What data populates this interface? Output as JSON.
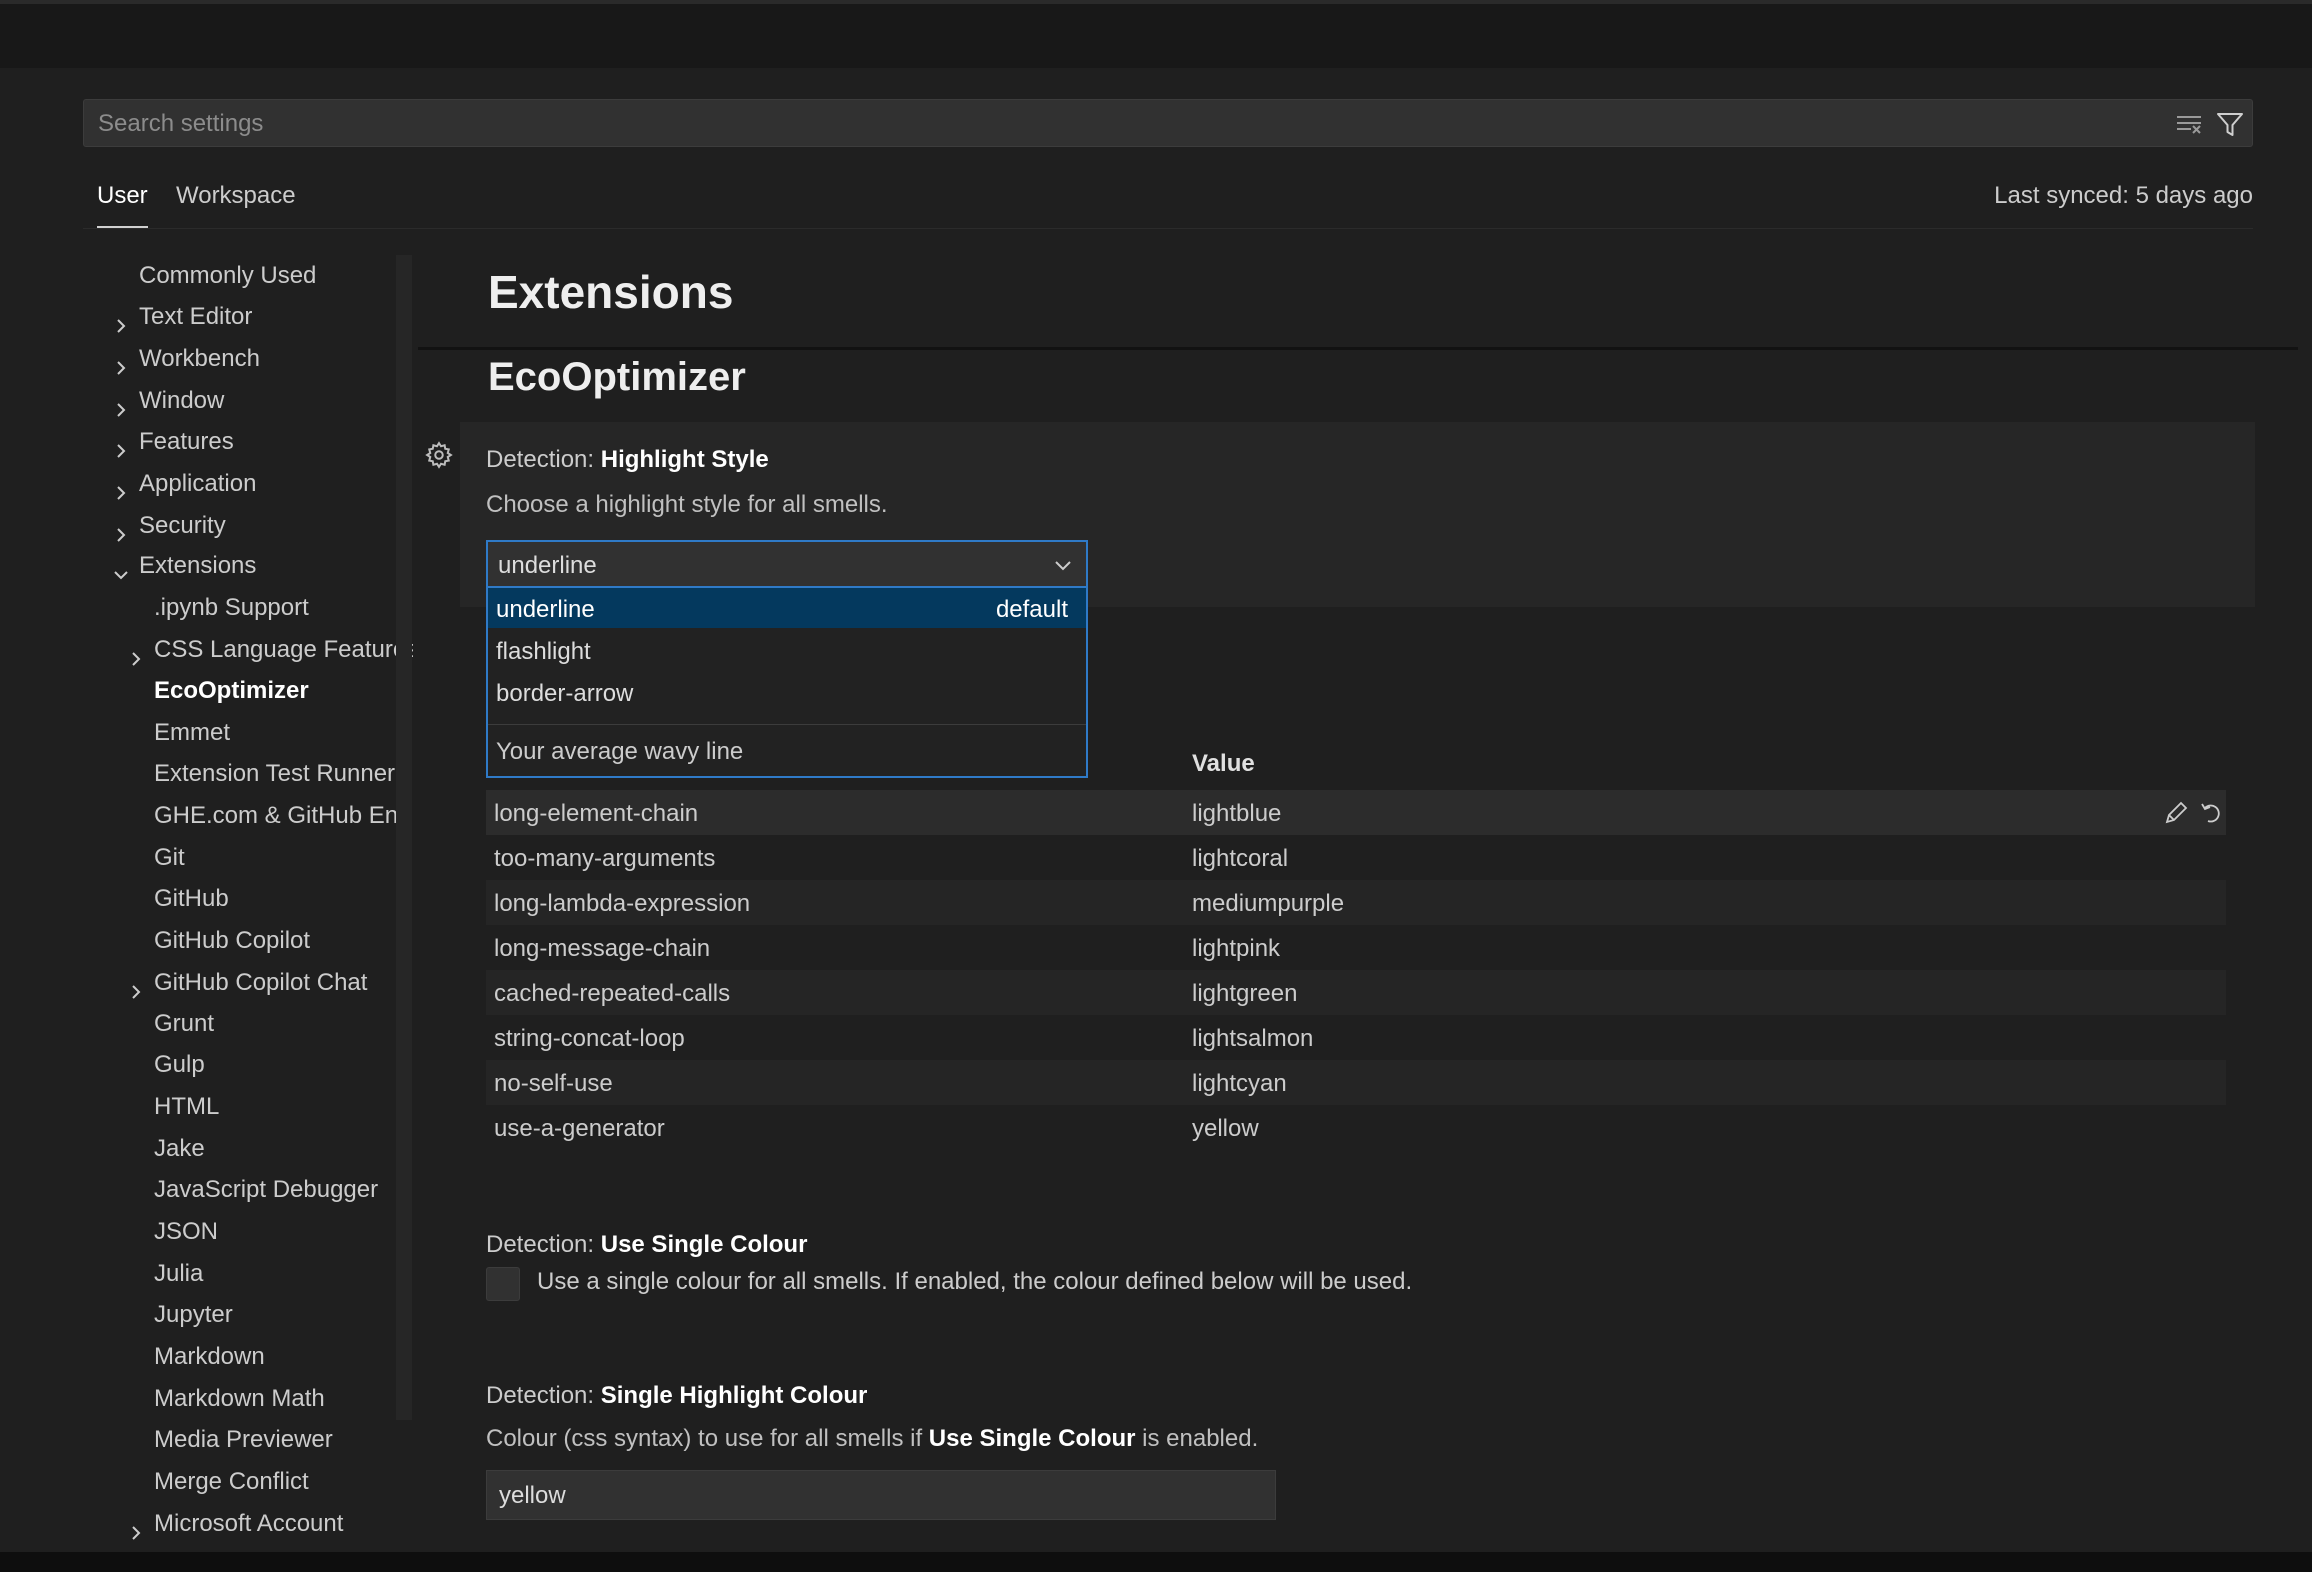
{
  "search": {
    "placeholder": "Search settings"
  },
  "tabs": [
    {
      "label": "User"
    },
    {
      "label": "Workspace"
    }
  ],
  "sync_status": "Last synced: 5 days ago",
  "toc": [
    {
      "label": "Commonly Used",
      "chevron": "none"
    },
    {
      "label": "Text Editor",
      "chevron": "right"
    },
    {
      "label": "Workbench",
      "chevron": "right"
    },
    {
      "label": "Window",
      "chevron": "right"
    },
    {
      "label": "Features",
      "chevron": "right"
    },
    {
      "label": "Application",
      "chevron": "right"
    },
    {
      "label": "Security",
      "chevron": "right"
    },
    {
      "label": "Extensions",
      "chevron": "down"
    },
    {
      "label": ".ipynb Support",
      "chevron": "none"
    },
    {
      "label": "CSS Language Features",
      "chevron": "right"
    },
    {
      "label": "EcoOptimizer",
      "chevron": "none",
      "active": true
    },
    {
      "label": "Emmet",
      "chevron": "none"
    },
    {
      "label": "Extension Test Runner",
      "chevron": "none"
    },
    {
      "label": "GHE.com & GitHub En...",
      "chevron": "none"
    },
    {
      "label": "Git",
      "chevron": "none"
    },
    {
      "label": "GitHub",
      "chevron": "none"
    },
    {
      "label": "GitHub Copilot",
      "chevron": "none"
    },
    {
      "label": "GitHub Copilot Chat",
      "chevron": "right"
    },
    {
      "label": "Grunt",
      "chevron": "none"
    },
    {
      "label": "Gulp",
      "chevron": "none"
    },
    {
      "label": "HTML",
      "chevron": "none"
    },
    {
      "label": "Jake",
      "chevron": "none"
    },
    {
      "label": "JavaScript Debugger",
      "chevron": "none"
    },
    {
      "label": "JSON",
      "chevron": "none"
    },
    {
      "label": "Julia",
      "chevron": "none"
    },
    {
      "label": "Jupyter",
      "chevron": "none"
    },
    {
      "label": "Markdown",
      "chevron": "none"
    },
    {
      "label": "Markdown Math",
      "chevron": "none"
    },
    {
      "label": "Media Previewer",
      "chevron": "none"
    },
    {
      "label": "Merge Conflict",
      "chevron": "none"
    },
    {
      "label": "Microsoft Account",
      "chevron": "right"
    }
  ],
  "main": {
    "heading": "Extensions",
    "subheading": "EcoOptimizer",
    "highlight_style": {
      "category": "Detection: ",
      "name": "Highlight Style",
      "description": "Choose a highlight style for all smells.",
      "selected": "underline",
      "options": [
        {
          "label": "underline",
          "badge": "default"
        },
        {
          "label": "flashlight",
          "badge": ""
        },
        {
          "label": "border-arrow",
          "badge": ""
        }
      ],
      "option_description": "Your average wavy line"
    },
    "colour_table": {
      "value_header": "Value",
      "rows": [
        {
          "key": "long-element-chain",
          "value": "lightblue"
        },
        {
          "key": "too-many-arguments",
          "value": "lightcoral"
        },
        {
          "key": "long-lambda-expression",
          "value": "mediumpurple"
        },
        {
          "key": "long-message-chain",
          "value": "lightpink"
        },
        {
          "key": "cached-repeated-calls",
          "value": "lightgreen"
        },
        {
          "key": "string-concat-loop",
          "value": "lightsalmon"
        },
        {
          "key": "no-self-use",
          "value": "lightcyan"
        },
        {
          "key": "use-a-generator",
          "value": "yellow"
        }
      ]
    },
    "single_colour": {
      "category": "Detection: ",
      "name": "Use Single Colour",
      "description": "Use a single colour for all smells. If enabled, the colour defined below will be used.",
      "checked": false
    },
    "single_highlight": {
      "category": "Detection: ",
      "name": "Single Highlight Colour",
      "description_before": "Colour (css syntax) to use for all smells if ",
      "description_bold": "Use Single Colour",
      "description_after": " is enabled.",
      "value": "yellow"
    }
  },
  "colors": {
    "accent": "#2f7ac7",
    "selected_option_bg": "#04395e",
    "background": "#1f1f1f"
  }
}
